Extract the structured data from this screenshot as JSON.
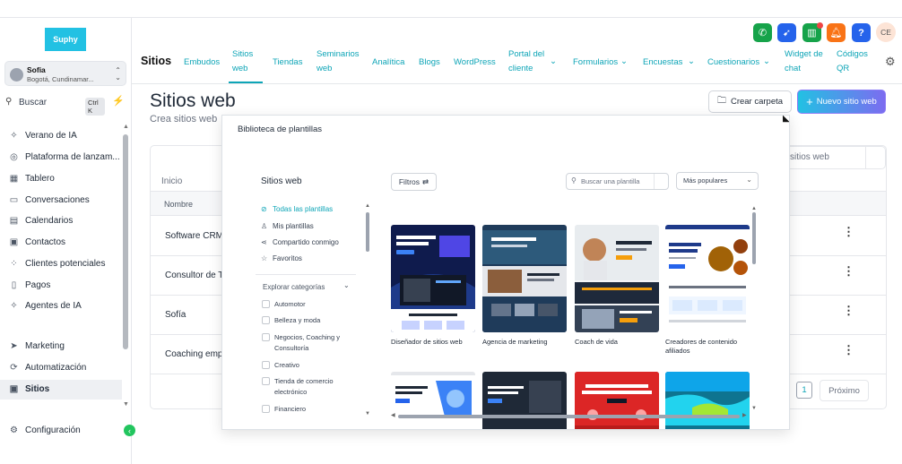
{
  "app": {
    "logo_text": "Suphy",
    "brand_colors": {
      "accent": "#0ea5b7",
      "logo_bg": "#22c1e3",
      "button_gradient_end": "#7c6cf0"
    }
  },
  "sidebar": {
    "location": {
      "name": "Sofia",
      "address": "Bogotá, Cundinamar..."
    },
    "search": {
      "label": "Buscar",
      "shortcut": "Ctrl K"
    },
    "items": [
      {
        "label": "Verano de IA",
        "icon": "sparkle-icon"
      },
      {
        "label": "Plataforma de lanzam...",
        "icon": "launchpad-icon"
      },
      {
        "label": "Tablero",
        "icon": "dashboard-icon"
      },
      {
        "label": "Conversaciones",
        "icon": "chat-icon"
      },
      {
        "label": "Calendarios",
        "icon": "calendar-icon"
      },
      {
        "label": "Contactos",
        "icon": "contacts-icon"
      },
      {
        "label": "Clientes potenciales",
        "icon": "opportunities-icon"
      },
      {
        "label": "Pagos",
        "icon": "payments-icon"
      },
      {
        "label": "Agentes de IA",
        "icon": "ai-agents-icon"
      },
      {
        "label": "Marketing",
        "icon": "send-icon"
      },
      {
        "label": "Automatización",
        "icon": "automation-icon"
      },
      {
        "label": "Sitios",
        "icon": "sites-icon"
      },
      {
        "label": "Configuración",
        "icon": "gear-icon"
      }
    ]
  },
  "header": {
    "section": "Sitios",
    "tabs": [
      {
        "label": "Embudos"
      },
      {
        "label": "Sitios web"
      },
      {
        "label": "Tiendas"
      },
      {
        "label": "Seminarios web"
      },
      {
        "label": "Analítica"
      },
      {
        "label": "Blogs"
      },
      {
        "label": "WordPress"
      },
      {
        "label": "Portal del cliente"
      },
      {
        "label": "Formularios"
      },
      {
        "label": "Encuestas"
      },
      {
        "label": "Cuestionarios"
      },
      {
        "label": "Widget de chat"
      },
      {
        "label": "Códigos QR"
      }
    ],
    "active_tab": "Sitios web",
    "avatar_initials": "CE",
    "top_buttons": [
      {
        "icon": "phone-icon",
        "color": "#16a34a"
      },
      {
        "icon": "megaphone-icon",
        "color": "#2563eb"
      },
      {
        "icon": "widget-icon",
        "color": "#16a34a"
      },
      {
        "icon": "bell-icon",
        "color": "#f97316"
      },
      {
        "icon": "help-icon",
        "color": "#2563eb"
      }
    ]
  },
  "page": {
    "title": "Sitios web",
    "subtitle": "Crea sitios web",
    "create_folder_label": "Crear carpeta",
    "new_site_label": "Nuevo sitio web",
    "search_placeholder": "sitios web",
    "breadcrumb": "Inicio",
    "table": {
      "column_name": "Nombre",
      "rows": [
        "Software CRM",
        "Consultor de T",
        "Sofía",
        "Coaching emp"
      ]
    },
    "pagination": {
      "current": "1",
      "next_label": "Próximo"
    }
  },
  "modal": {
    "title": "Biblioteca de plantillas",
    "sidebar_heading": "Sitios web",
    "filters": [
      {
        "label": "Todas las plantillas",
        "icon": "check-circle-icon",
        "active": true
      },
      {
        "label": "Mis plantillas",
        "icon": "user-icon",
        "active": false
      },
      {
        "label": "Compartido conmigo",
        "icon": "share-icon",
        "active": false
      },
      {
        "label": "Favoritos",
        "icon": "star-icon",
        "active": false
      }
    ],
    "explore_label": "Explorar categorías",
    "categories": [
      "Automotor",
      "Belleza y moda",
      "Negocios, Coaching y Consultoría",
      "Creativo",
      "Tienda de comercio electrónico",
      "Financiero"
    ],
    "filters_button": "Filtros",
    "search_placeholder": "Buscar una plantilla",
    "sort_value": "Más populares",
    "templates": [
      {
        "label": "Diseñador de sitios web"
      },
      {
        "label": "Agencia de marketing"
      },
      {
        "label": "Coach de vida"
      },
      {
        "label": "Creadores de contenido afiliados"
      },
      {
        "label": ""
      },
      {
        "label": ""
      },
      {
        "label": ""
      },
      {
        "label": ""
      }
    ]
  }
}
